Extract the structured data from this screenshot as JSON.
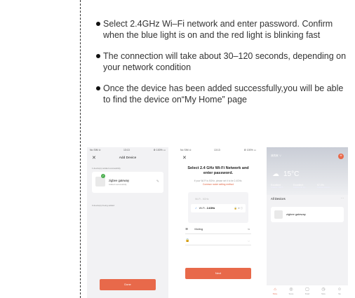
{
  "instructions": [
    "Select 2.4GHz Wi–Fi network and enter password. Confirm when the blue light is on and the red light is blinking fast",
    "The connection will take about 30–120 seconds, depending on your network condition",
    "Once the device has been added successfully,you will be able to find the device on“My Home” page"
  ],
  "phone1": {
    "status_left": "No SIM ⊙",
    "status_time": "13:13",
    "status_right": "⚙ 100% ▭",
    "title": "Add Device",
    "section_added": "1 device(s) added successfully",
    "device_name": "zigbee gateway",
    "device_sub": "Added successfully",
    "section_pending": "0 device(s) being added",
    "done_label": "Done"
  },
  "phone2": {
    "status_left": "No SIM ⊙",
    "status_time": "13:13",
    "status_right": "⚙ 100% ▭",
    "heading": "Select 2.4 GHz Wi-Fi Network and enter password.",
    "hint": "If your Wi-Fi is 5GHz, please set it to be 2.4GHz.",
    "hint_link": "Common router setting method",
    "wifi_5g": "Wi-Fi - 5GHz",
    "wifi_24_prefix": "Wi-Fi -",
    "wifi_24_band": "2.4GHz",
    "network_name": "Moling",
    "password_placeholder": "",
    "next_label": "Next"
  },
  "phone3": {
    "status_left": "No SIM ⊙",
    "status_time": "13:14",
    "status_right": "⚙ 100% ▭",
    "home_selector": "我的家 ∨",
    "temperature": "15°C",
    "metrics": [
      {
        "value": "Excellent",
        "label": "Outdoor PM2.5"
      },
      {
        "value": "Excellent",
        "label": "Outdoor Air Qu..."
      },
      {
        "value": "97.0%",
        "label": "Outdoor Humid..."
      }
    ],
    "all_devices": "All Devices",
    "device_name": "zigbee gateway",
    "tabs": [
      "Home",
      "Scene",
      "Smart",
      "Store",
      "Me"
    ]
  }
}
